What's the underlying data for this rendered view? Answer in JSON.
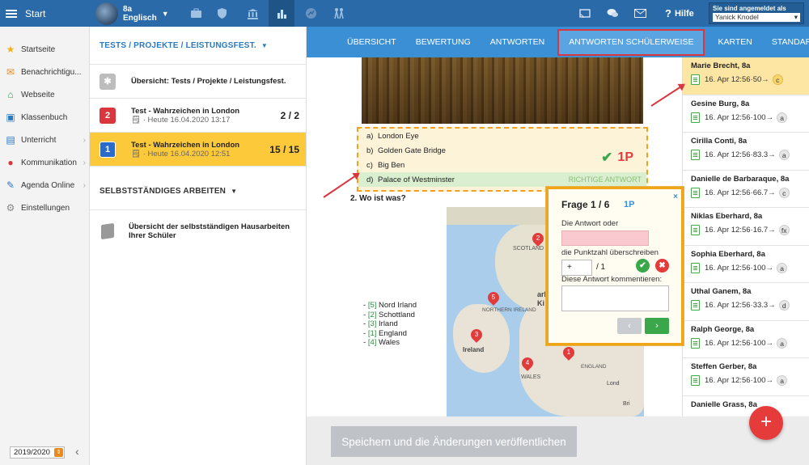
{
  "topbar": {
    "start_label": "Start",
    "class_name": "8a",
    "class_subject": "Englisch",
    "icons": [
      "briefcase-icon",
      "shield-icon",
      "building-icon",
      "chart-icon",
      "chart-circle-icon",
      "people-icon"
    ],
    "help_label": "Hilfe",
    "user_heading": "Sie sind angemeldet als",
    "user_name": "Yanick Knodel"
  },
  "leftnav": {
    "items": [
      {
        "label": "Startseite",
        "icon": "star-icon",
        "color": "#f2b21b"
      },
      {
        "label": "Benachrichtigu...",
        "icon": "mail-icon",
        "color": "#e98a1f"
      },
      {
        "label": "Webseite",
        "icon": "home-icon",
        "color": "#2c9a5a"
      },
      {
        "label": "Klassenbuch",
        "icon": "book-icon",
        "color": "#2a7ac0"
      },
      {
        "label": "Unterricht",
        "icon": "books-icon",
        "color": "#2a7ac0"
      },
      {
        "label": "Kommunikation",
        "icon": "chat-icon",
        "color": "#d9363e"
      },
      {
        "label": "Agenda Online",
        "icon": "pen-icon",
        "color": "#2a7ac0"
      },
      {
        "label": "Einstellungen",
        "icon": "gear-icon",
        "color": "#888888"
      }
    ],
    "school_year": "2019/2020"
  },
  "middle": {
    "section1_title": "TESTS / PROJEKTE / LEISTUNGSFEST.",
    "overview_label": "Übersicht: Tests / Projekte / Leistungsfest.",
    "tests": [
      {
        "badge": "2",
        "badge_color": "#d9363e",
        "title": "Test - Wahrzeichen in London",
        "date": "Heute 16.04.2020 13:17",
        "score": "2 / 2"
      },
      {
        "badge": "1",
        "badge_color": "#2a6ac8",
        "title": "Test - Wahrzeichen in London",
        "date": "Heute 16.04.2020 12:51",
        "score": "15 / 15"
      }
    ],
    "section2_title": "SELBSTSTÄNDIGES ARBEITEN",
    "homework_label": "Übersicht der selbstständigen Hausarbeiten Ihrer Schüler"
  },
  "tabs": [
    "ÜBERSICHT",
    "BEWERTUNG",
    "ANTWORTEN",
    "ANTWORTEN SCHÜLERWEISE",
    "KARTEN",
    "STANDARDS",
    "STAN"
  ],
  "active_tab": "ANTWORTEN SCHÜLERWEISE",
  "question1": {
    "answers": [
      {
        "letter": "a)",
        "text": "London Eye"
      },
      {
        "letter": "b)",
        "text": "Golden Gate Bridge"
      },
      {
        "letter": "c)",
        "text": "Big Ben"
      },
      {
        "letter": "d)",
        "text": "Palace of Westminster"
      }
    ],
    "correct_tag": "RICHTIGE ANTWORT",
    "points": "1P"
  },
  "question2": {
    "title": "2.  Wo ist was?",
    "legend": [
      {
        "num": "[5]",
        "label": "Nord Irland"
      },
      {
        "num": "[2]",
        "label": "Schottland"
      },
      {
        "num": "[3]",
        "label": "Irland"
      },
      {
        "num": "[1]",
        "label": "England"
      },
      {
        "num": "[4]",
        "label": "Wales"
      }
    ],
    "map_labels": [
      "SCOTLAND",
      "NORTHERN IRELAND",
      "Ireland",
      "WALES",
      "ENGLAND",
      "Ki",
      "ark",
      "Lond",
      "Bri"
    ],
    "pins": [
      "2",
      "5",
      "3",
      "4",
      "1"
    ]
  },
  "popup": {
    "title": "Frage 1 / 6",
    "points": "1P",
    "answer_label": "Die Antwort oder",
    "override_label": "die Punktzahl überschreiben",
    "score_value": "+",
    "score_total": "/ 1",
    "comment_label": "Diese Antwort kommentieren:",
    "prev": "‹",
    "next": "›",
    "close": "×"
  },
  "students": [
    {
      "name": "Marie Brecht, 8a",
      "date": "16. Apr 12:56",
      "score": "50",
      "grade": "c"
    },
    {
      "name": "Gesine Burg, 8a",
      "date": "16. Apr 12:56",
      "score": "100",
      "grade": "a"
    },
    {
      "name": "Cirilla Conti, 8a",
      "date": "16. Apr 12:56",
      "score": "83.3",
      "grade": "a"
    },
    {
      "name": "Danielle de Barbaraque, 8a",
      "date": "16. Apr 12:56",
      "score": "66.7",
      "grade": "c"
    },
    {
      "name": "Niklas Eberhard, 8a",
      "date": "16. Apr 12:56",
      "score": "16.7",
      "grade": "fx"
    },
    {
      "name": "Sophia Eberhard, 8a",
      "date": "16. Apr 12:56",
      "score": "100",
      "grade": "a"
    },
    {
      "name": "Uthal Ganem, 8a",
      "date": "16. Apr 12:56",
      "score": "33.3",
      "grade": "d"
    },
    {
      "name": "Ralph George, 8a",
      "date": "16. Apr 12:56",
      "score": "100",
      "grade": "a"
    },
    {
      "name": "Steffen Gerber, 8a",
      "date": "16. Apr 12:56",
      "score": "100",
      "grade": "a"
    },
    {
      "name": "Danielle Grass, 8a",
      "date": "",
      "score": "",
      "grade": ""
    }
  ],
  "save_label": "Speichern und die Änderungen veröffentlichen",
  "fab_label": "+"
}
